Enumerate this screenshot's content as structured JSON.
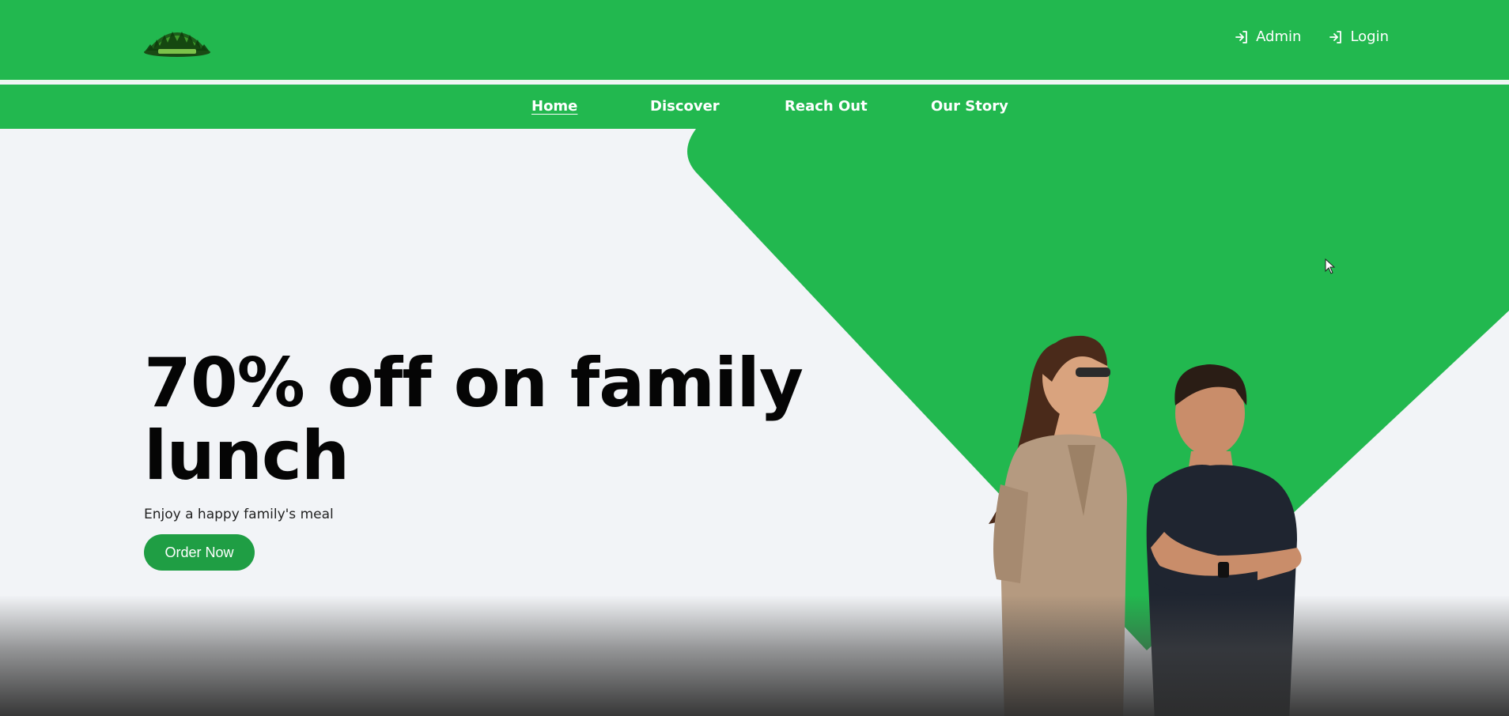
{
  "header": {
    "logo_name": "brand-logo",
    "auth_links": [
      {
        "label": "Admin",
        "icon": "login-arrow-icon"
      },
      {
        "label": "Login",
        "icon": "login-arrow-icon"
      }
    ]
  },
  "nav": {
    "items": [
      {
        "label": "Home",
        "active": true
      },
      {
        "label": "Discover",
        "active": false
      },
      {
        "label": "Reach Out",
        "active": false
      },
      {
        "label": "Our Story",
        "active": false
      }
    ]
  },
  "hero": {
    "headline": "70% off on family lunch",
    "subtitle": "Enjoy a happy family's meal",
    "cta_label": "Order Now"
  },
  "colors": {
    "brand_green": "#22b84f",
    "button_green": "#1f9e44",
    "page_background": "#f2f4f7",
    "headline_text": "#050505"
  }
}
